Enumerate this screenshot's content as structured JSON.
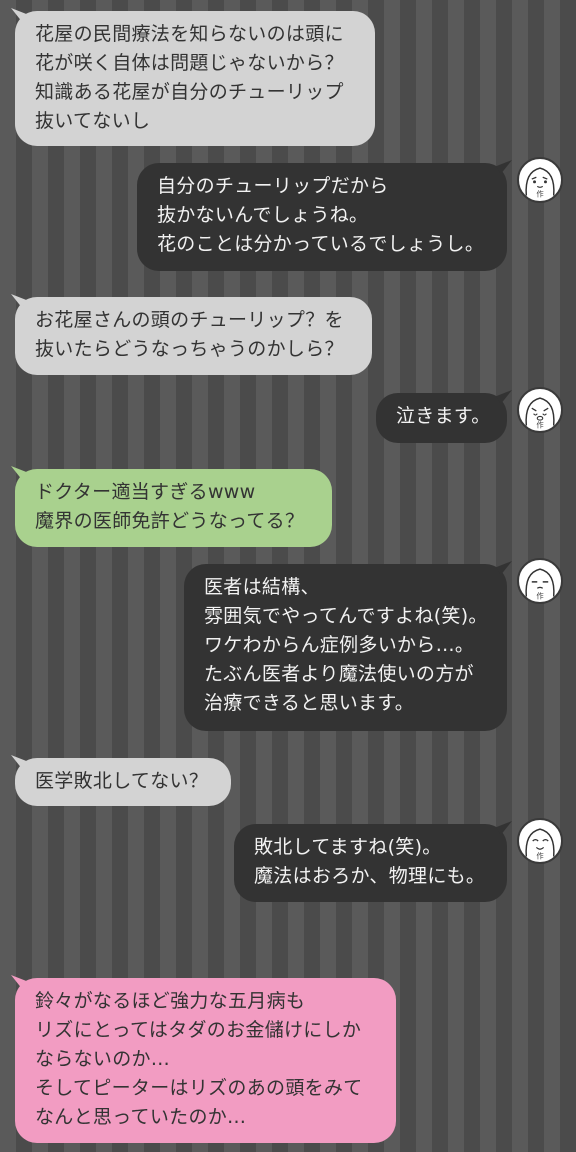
{
  "messages": [
    {
      "side": "left",
      "color": "gray",
      "lines": [
        "花屋の民間療法を知らないのは頭に",
        "花が咲く自体は問題じゃないから？",
        "知識ある花屋が自分のチューリップ",
        "抜いてないし"
      ]
    },
    {
      "side": "right",
      "lines": [
        "自分のチューリップだから",
        "抜かないんでしょうね。",
        "花のことは分かっているでしょうし。"
      ],
      "avatar": {
        "icon": "author-avatar-icon",
        "label": "作"
      }
    },
    {
      "side": "left",
      "color": "gray",
      "lines": [
        "お花屋さんの頭のチューリップ？を",
        "抜いたらどうなっちゃうのかしら？"
      ]
    },
    {
      "side": "right",
      "lines": [
        "泣きます。"
      ],
      "avatar": {
        "icon": "author-avatar-icon",
        "label": "作"
      }
    },
    {
      "side": "left",
      "color": "green",
      "lines": [
        "ドクター適当すぎるwww",
        "魔界の医師免許どうなってる？"
      ]
    },
    {
      "side": "right",
      "lines": [
        "医者は結構、",
        "雰囲気でやってんですよね(笑)。",
        "ワケわからん症例多いから…。",
        "たぶん医者より魔法使いの方が",
        "治療できると思います。"
      ],
      "avatar": {
        "icon": "author-avatar-icon",
        "label": "作"
      }
    },
    {
      "side": "left",
      "color": "gray",
      "lines": [
        "医学敗北してない？"
      ]
    },
    {
      "side": "right",
      "lines": [
        "敗北してますね(笑)。",
        "魔法はおろか、物理にも。"
      ],
      "avatar": {
        "icon": "author-avatar-icon",
        "label": "作"
      }
    },
    {
      "side": "left",
      "color": "pink",
      "lines": [
        "鈴々がなるほど強力な五月病も",
        "リズにとってはタダのお金儲けにしか",
        "ならないのか…",
        "そしてピーターはリズのあの頭をみて",
        "なんと思っていたのか…"
      ]
    }
  ],
  "colors": {
    "gray": "#d3d3d3",
    "green": "#a9d18e",
    "pink": "#f29cc2",
    "dark": "#333333"
  }
}
